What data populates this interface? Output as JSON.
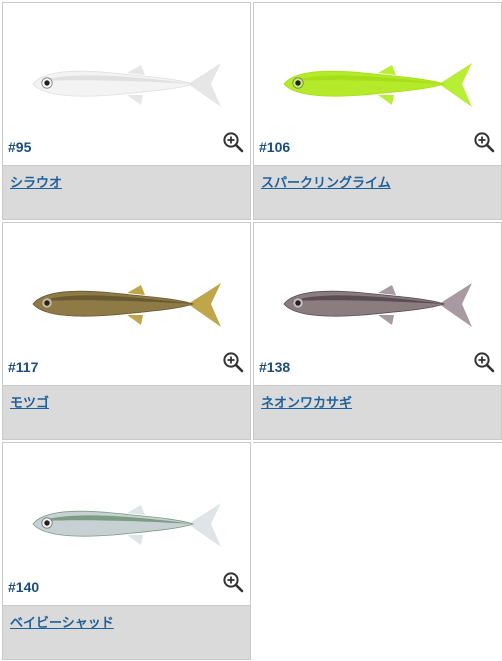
{
  "products": [
    {
      "code": "#95",
      "name": "シラウオ",
      "zoom_icon": "zoom-in-icon",
      "color_body": "#f3f3f3",
      "color_back": "#e0e0e0",
      "color_belly": "#ffffff",
      "color_tail": "#e6e6e6"
    },
    {
      "code": "#106",
      "name": "スパークリングライム",
      "zoom_icon": "zoom-in-icon",
      "color_body": "#b5ea2a",
      "color_back": "#a6df1a",
      "color_belly": "#c8f25a",
      "color_tail": "#b9ee36"
    },
    {
      "code": "#117",
      "name": "モツゴ",
      "zoom_icon": "zoom-in-icon",
      "color_body": "#8e7a45",
      "color_back": "#6a5a32",
      "color_belly": "#cdbb88",
      "color_tail": "#c0a64a"
    },
    {
      "code": "#138",
      "name": "ネオンワカサギ",
      "zoom_icon": "zoom-in-icon",
      "color_body": "#8b7c80",
      "color_back": "#5a4d54",
      "color_belly": "#c9bcc0",
      "color_tail": "#a89aa0"
    },
    {
      "code": "#140",
      "name": "ベイビーシャッド",
      "zoom_icon": "zoom-in-icon",
      "color_body": "#c7d0d2",
      "color_back": "#7d9c84",
      "color_belly": "#eef1f1",
      "color_tail": "#dfe5e6"
    }
  ]
}
